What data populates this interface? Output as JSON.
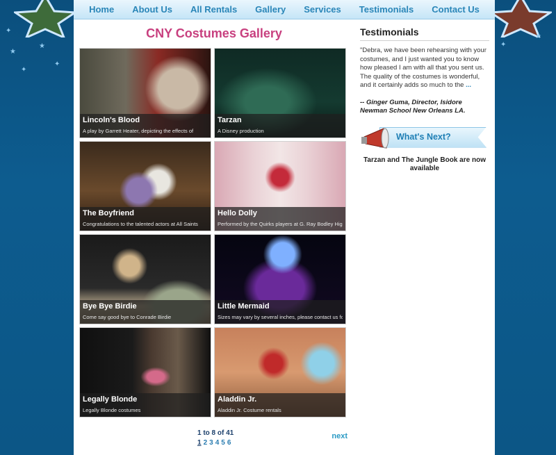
{
  "nav": {
    "items": [
      "Home",
      "About Us",
      "All Rentals",
      "Gallery",
      "Services",
      "Testimonials",
      "Contact Us"
    ]
  },
  "gallery": {
    "title": "CNY Costumes Gallery",
    "items": [
      {
        "title": "Lincoln's Blood",
        "desc": "A play by Garrett Heater, depicting the effects of"
      },
      {
        "title": "Tarzan",
        "desc": "A Disney production"
      },
      {
        "title": "The Boyfriend",
        "desc": "Congratulations to the talented actors at All Saints"
      },
      {
        "title": "Hello Dolly",
        "desc": "Performed by the Quirks players at G. Ray Bodley High"
      },
      {
        "title": "Bye Bye Birdie",
        "desc": "Come say good bye to Conrade Birdie"
      },
      {
        "title": "Little Mermaid",
        "desc": "Sizes may vary by several inches, please contact us for"
      },
      {
        "title": "Legally Blonde",
        "desc": "Legally Blonde costumes"
      },
      {
        "title": "Aladdin Jr.",
        "desc": "Aladdin Jr. Costume rentals"
      }
    ],
    "pager": {
      "range": "1 to 8 of 41",
      "pages": [
        "1",
        "2",
        "3",
        "4",
        "5",
        "6"
      ],
      "current": "1",
      "next": "next"
    }
  },
  "sidebar": {
    "heading": "Testimonials",
    "quote": "\"Debra, we have been rehearsing with your costumes, and I just wanted you to know how pleased I am with all that you sent us. The quality of the costumes is wonderful, and it certainly adds so much to the",
    "more": "...",
    "attribution": "-- Ginger Guma, Director, Isidore Newman School New Orleans LA.",
    "whats_next": {
      "label": "What's Next?",
      "note": "Tarzan and The Jungle Book are now available"
    }
  }
}
